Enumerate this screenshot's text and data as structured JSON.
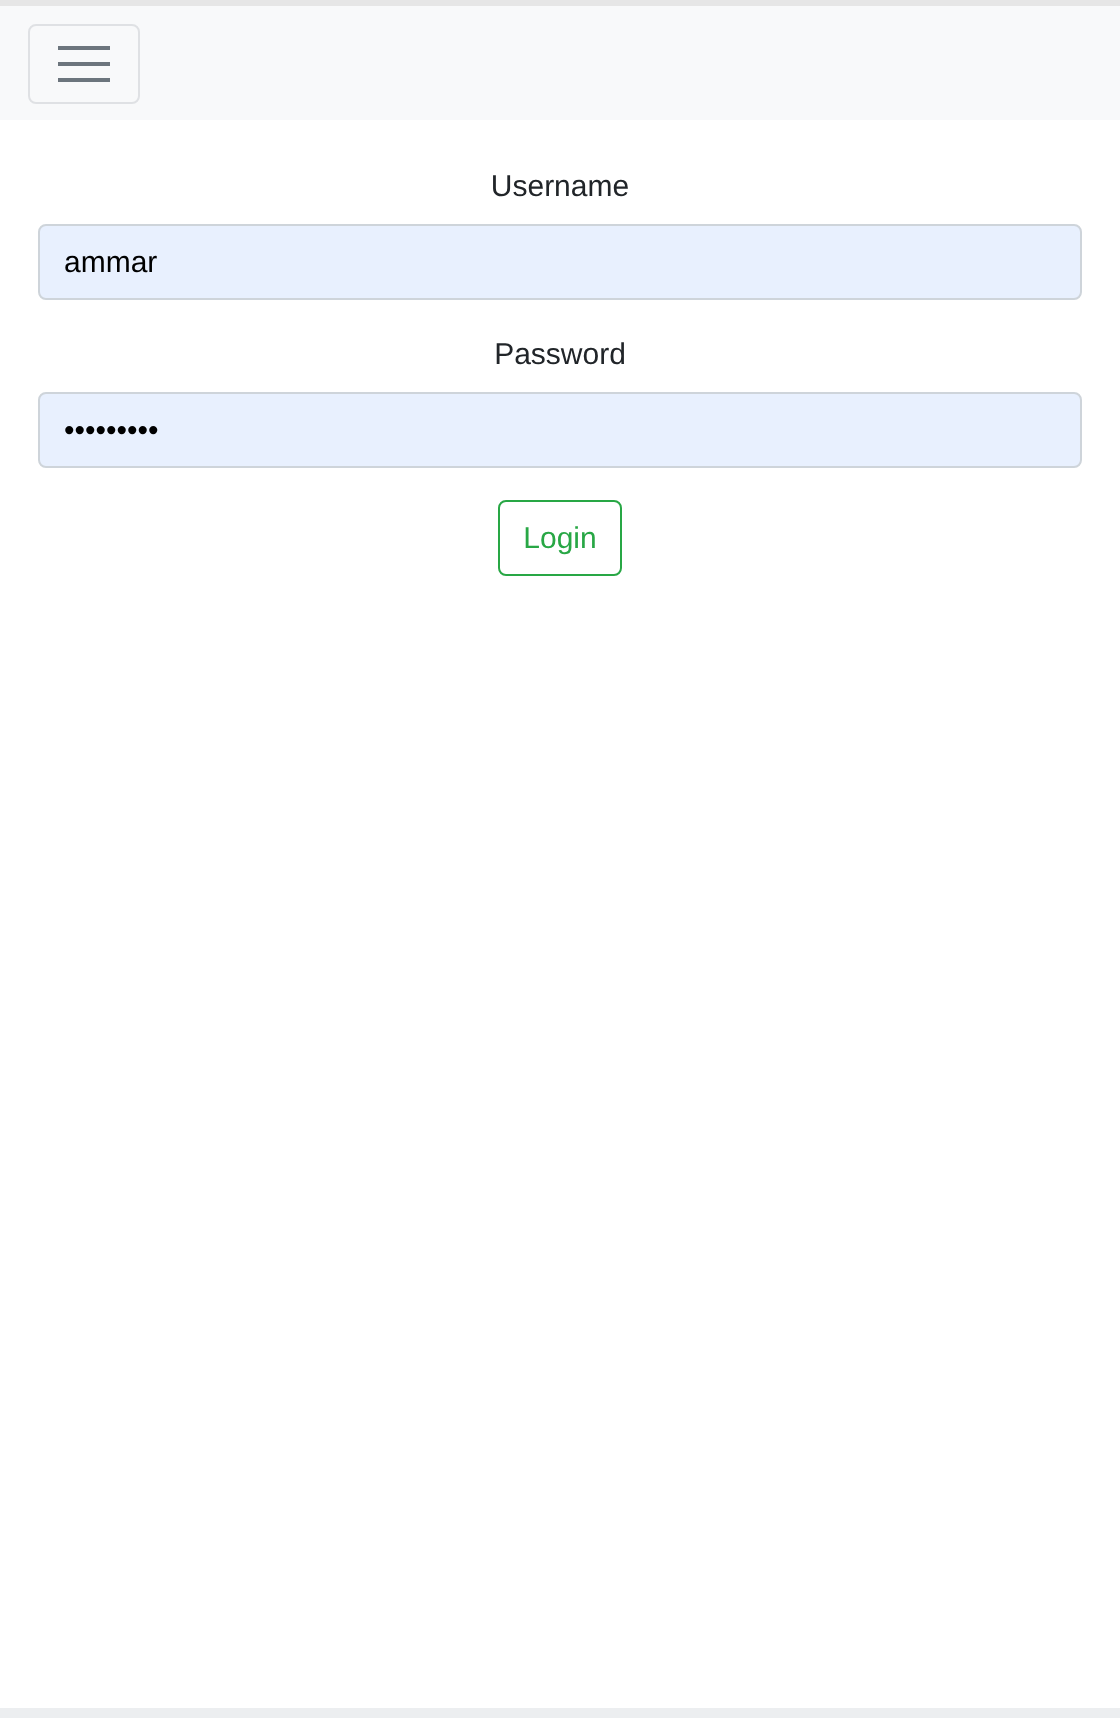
{
  "form": {
    "fields": [
      {
        "label": "Username",
        "value": "ammar"
      },
      {
        "label": "Password",
        "value": "•••••••••"
      }
    ],
    "submit": "Login"
  }
}
